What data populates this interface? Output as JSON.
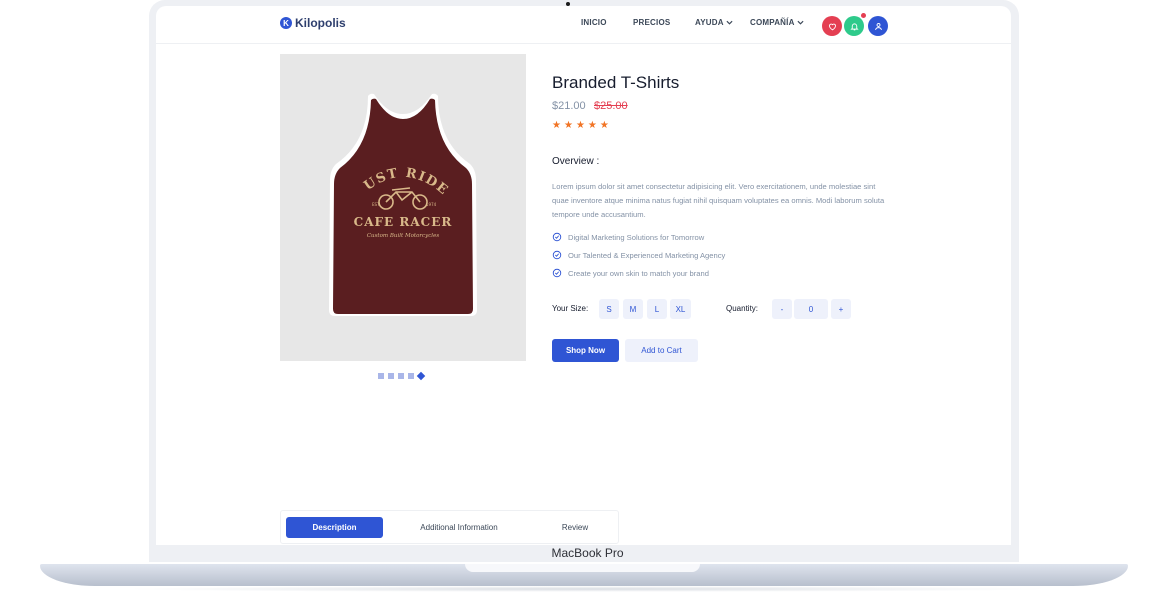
{
  "device": {
    "model": "MacBook Pro"
  },
  "header": {
    "brand": "Kilopolis",
    "brand_mark": "K",
    "nav": [
      {
        "label": "INICIO",
        "has_chevron": false
      },
      {
        "label": "PRECIOS",
        "has_chevron": false
      },
      {
        "label": "AYUDA",
        "has_chevron": true
      },
      {
        "label": "COMPAÑÍA",
        "has_chevron": true
      }
    ],
    "icon_buttons": [
      {
        "icon": "heart-icon",
        "color": "#e43f52"
      },
      {
        "icon": "bell-icon",
        "color": "#2eca8b"
      },
      {
        "icon": "user-icon",
        "color": "#2f55d4"
      }
    ]
  },
  "product": {
    "title": "Branded T-Shirts",
    "price": "$21.00",
    "old_price": "$25.00",
    "rating_stars": 5,
    "overview_title": "Overview :",
    "overview_text": "Lorem ipsum dolor sit amet consectetur adipisicing elit. Vero exercitationem, unde molestiae sint quae inventore atque minima natus fugiat nihil quisquam voluptates ea omnis. Modi laborum soluta tempore unde accusantium.",
    "features": [
      "Digital Marketing Solutions for Tomorrow",
      "Our Talented & Experienced Marketing Agency",
      "Create your own skin to match your brand"
    ],
    "size_label": "Your Size:",
    "sizes": [
      "S",
      "M",
      "L",
      "XL"
    ],
    "quantity_label": "Quantity:",
    "quantity": {
      "minus": "-",
      "value": "0",
      "plus": "+"
    },
    "shop_now": "Shop Now",
    "add_to_cart": "Add to Cart",
    "image": {
      "line1": "JUST RIDE",
      "est": "EST.",
      "year": "1974",
      "line2": "CAFE RACER",
      "line3": "Custom Built Motorcycles"
    },
    "thumbnails_count": 5,
    "active_thumbnail": 5
  },
  "tabs": [
    "Description",
    "Additional Information",
    "Review"
  ],
  "active_tab": "Description",
  "colors": {
    "primary": "#2f55d4",
    "danger": "#e43f52",
    "success": "#2eca8b",
    "star": "#f17425",
    "muted": "#8492a6",
    "shirt": "#5a1e20"
  }
}
